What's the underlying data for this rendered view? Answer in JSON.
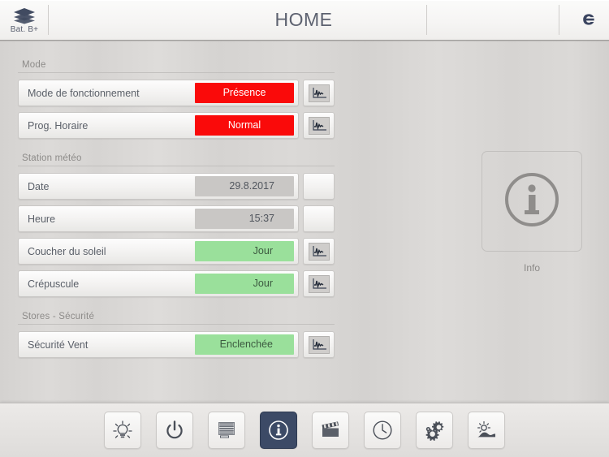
{
  "header": {
    "left_icon": "layers-icon",
    "left_label": "Bat. B+",
    "title": "HOME",
    "logo": "e"
  },
  "groups": [
    {
      "title": "Mode",
      "rows": [
        {
          "label": "Mode de fonctionnement",
          "value": "Présence",
          "state": "red",
          "has_trend": true
        },
        {
          "label": "Prog. Horaire",
          "value": "Normal",
          "state": "red",
          "has_trend": true
        }
      ]
    },
    {
      "title": "Station météo",
      "rows": [
        {
          "label": "Date",
          "value": "29.8.2017",
          "state": "grey",
          "has_trend": false
        },
        {
          "label": "Heure",
          "value": "15:37",
          "state": "grey",
          "has_trend": false
        },
        {
          "label": "Coucher du soleil",
          "value": "Jour",
          "state": "green",
          "has_trend": true
        },
        {
          "label": "Crépuscule",
          "value": "Jour",
          "state": "green",
          "has_trend": true
        }
      ]
    },
    {
      "title": "Stores - Sécurité",
      "rows": [
        {
          "label": "Sécurité Vent",
          "value": "Enclenchée",
          "state": "green",
          "has_trend": true
        }
      ]
    }
  ],
  "info_panel": {
    "icon": "info-circle-icon",
    "caption": "Info"
  },
  "toolbar": {
    "items": [
      {
        "icon": "light-bulb-icon",
        "active": false
      },
      {
        "icon": "power-icon",
        "active": false
      },
      {
        "icon": "blinds-icon",
        "active": false
      },
      {
        "icon": "info-circle-icon",
        "active": true
      },
      {
        "icon": "clapperboard-icon",
        "active": false
      },
      {
        "icon": "clock-icon",
        "active": false
      },
      {
        "icon": "gears-icon",
        "active": false
      },
      {
        "icon": "weather-sun-icon",
        "active": false
      }
    ]
  },
  "colors": {
    "alarm_red": "#fa0a0a",
    "ok_green": "#9ae09b",
    "neutral_grey": "#c9c7c5",
    "active_tab": "#3c4a66",
    "title_text": "#5d6270"
  }
}
